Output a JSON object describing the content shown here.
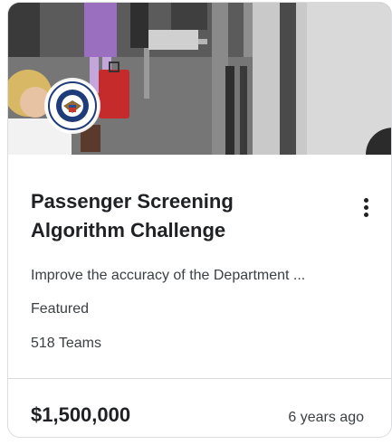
{
  "card": {
    "image_alt": "Airport security screening checkpoint with DHS seal",
    "seal_icon": "department-of-homeland-security-seal",
    "title": "Passenger Screening Algorithm Challenge",
    "description": "Improve the accuracy of the Department ...",
    "tag": "Featured",
    "teams": "518 Teams",
    "prize": "$1,500,000",
    "age": "6 years ago",
    "menu_icon": "more-vert-icon"
  },
  "colors": {
    "text_primary": "#202124",
    "text_secondary": "#3c4043",
    "border": "#dadce0"
  }
}
